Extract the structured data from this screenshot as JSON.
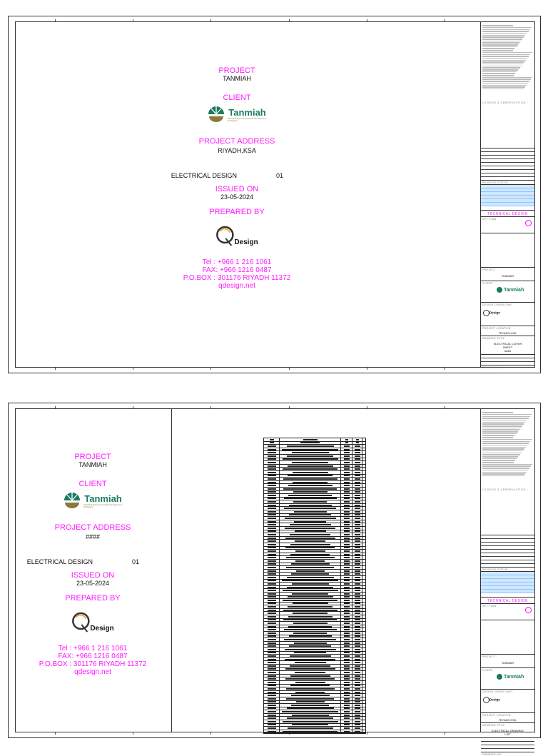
{
  "sheets": [
    {
      "project_label": "PROJECT",
      "project": "TANMIAH",
      "client_label": "CLIENT",
      "client_logo_text": "Tanmiah",
      "client_logo_sub": "National Program for Community Development in the Regions",
      "address_label": "PROJECT ADDRESS",
      "address": "RIYADH,KSA",
      "design_label": "ELECTRICAL DESIGN",
      "design_num": "01",
      "issued_label": "ISSUED ON",
      "issued": "23-05-2024",
      "prepared_label": "PREPARED BY",
      "consultant_logo_text": "Design",
      "tel": "Tel : +966 1 216 1061",
      "fax": "FAX: +966 1216 0487",
      "pobox": "P.O.BOX : 301176 RIYADH 11372",
      "web": "qdesign.net",
      "titleblock": {
        "legend": "LEGEND & ABBREVIATION :",
        "revision": "REVISION STATUS",
        "technical": "TECHNICAL DESIGN",
        "keyplan": "KEY PLAN",
        "project_label": "PROJECT :",
        "project": "TANMIAH",
        "client_label": "CLIENT :",
        "consultant_label": "DESIGN CONSULTANT",
        "location_label": "PROJECT LOCATION",
        "location": "RIYADH,KSA",
        "drawing_title_label": "DRAWING TITLE",
        "drawing_title": "ELECTRICAL COVER SHEET",
        "drawing_code": "####",
        "drawing_no_label": "DRAWING NO."
      }
    },
    {
      "project_label": "PROJECT",
      "project": "TANMIAH",
      "client_label": "CLIENT",
      "client_logo_text": "Tanmiah",
      "client_logo_sub": "National Program for Community Development in the Regions",
      "address_label": "PROJECT ADDRESS",
      "address": "####",
      "design_label": "ELECTRICAL DESIGN",
      "design_num": "01",
      "issued_label": "ISSUED ON",
      "issued": "23-05-2024",
      "prepared_label": "PREPARED BY",
      "consultant_logo_text": "Design",
      "tel": "Tel : +966 1 216 1061",
      "fax": "FAX: +966 1216 0487",
      "pobox": "P.O.BOX : 301176 RIYADH 11372",
      "web": "qdesign.net",
      "titleblock": {
        "legend": "LEGEND & ABBREVIATION :",
        "revision": "REVISION STATUS",
        "technical": "TECHNICAL DESIGN",
        "keyplan": "KEY PLAN",
        "project_label": "PROJECT :",
        "project": "TANMIAH",
        "client_label": "CLIENT :",
        "consultant_label": "DESIGN CONSULTANT",
        "location_label": "PROJECT LOCATION",
        "location": "RIYADH,KSA",
        "drawing_title_label": "DRAWING TITLE",
        "drawing_title": "ELECTRICAL DRAWING LIST",
        "drawing_code": "",
        "drawing_no_label": "DRAWING NO."
      }
    }
  ],
  "colors": {
    "accent": "#ff19ff",
    "brand_green": "#1a7a5e",
    "brand_gold": "#8a7a3a"
  }
}
